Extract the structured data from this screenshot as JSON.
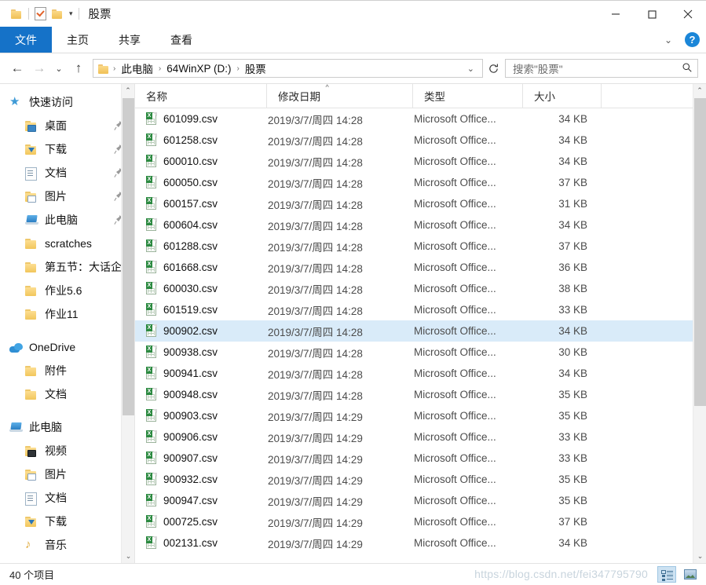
{
  "window": {
    "title": "股票",
    "quick_access_toolbar": [
      {
        "icon": "folder-icon",
        "name": "explorer-icon"
      },
      {
        "icon": "properties-icon",
        "name": "properties-icon"
      },
      {
        "icon": "folder-icon",
        "name": "new-folder-icon"
      },
      {
        "icon": "chevron-down-icon",
        "name": "customize-qat-icon"
      }
    ],
    "controls": {
      "minimize": "—",
      "maximize": "☐",
      "close": "✕"
    }
  },
  "ribbon": {
    "tabs": [
      {
        "label": "文件",
        "active": true
      },
      {
        "label": "主页",
        "active": false
      },
      {
        "label": "共享",
        "active": false
      },
      {
        "label": "查看",
        "active": false
      }
    ],
    "expand_icon": "chevron-down-icon",
    "help_label": "?"
  },
  "navbar": {
    "back_icon": "arrow-left-icon",
    "forward_icon": "arrow-right-icon",
    "recent_icon": "chevron-down-icon",
    "up_icon": "arrow-up-icon",
    "breadcrumb": [
      "此电脑",
      "64WinXP (D:)",
      "股票"
    ],
    "breadcrumb_separator": "›",
    "address_dropdown_icon": "chevron-down-icon",
    "refresh_icon": "refresh-icon",
    "search": {
      "placeholder": "搜索\"股票\"",
      "icon": "search-icon"
    }
  },
  "sidebar": {
    "sections": [
      {
        "header": {
          "label": "快速访问",
          "icon": "star-icon"
        },
        "items": [
          {
            "label": "桌面",
            "icon": "folder-desktop-icon",
            "pinned": true
          },
          {
            "label": "下载",
            "icon": "folder-downloads-icon",
            "pinned": true
          },
          {
            "label": "文档",
            "icon": "folder-documents-icon",
            "pinned": true
          },
          {
            "label": "图片",
            "icon": "folder-pictures-icon",
            "pinned": true
          },
          {
            "label": "此电脑",
            "icon": "computer-icon",
            "pinned": true
          },
          {
            "label": "scratches",
            "icon": "folder-icon",
            "pinned": false
          },
          {
            "label": "第五节：大话企业",
            "icon": "folder-icon",
            "pinned": false
          },
          {
            "label": "作业5.6",
            "icon": "folder-icon",
            "pinned": false
          },
          {
            "label": "作业11",
            "icon": "folder-icon",
            "pinned": false
          }
        ]
      },
      {
        "header": {
          "label": "OneDrive",
          "icon": "onedrive-icon"
        },
        "items": [
          {
            "label": "附件",
            "icon": "folder-icon",
            "pinned": false
          },
          {
            "label": "文档",
            "icon": "folder-icon",
            "pinned": false
          }
        ]
      },
      {
        "header": {
          "label": "此电脑",
          "icon": "computer-icon"
        },
        "items": [
          {
            "label": "视频",
            "icon": "folder-videos-icon",
            "pinned": false
          },
          {
            "label": "图片",
            "icon": "folder-pictures-icon",
            "pinned": false
          },
          {
            "label": "文档",
            "icon": "folder-documents-icon",
            "pinned": false
          },
          {
            "label": "下载",
            "icon": "folder-downloads-icon",
            "pinned": false
          },
          {
            "label": "音乐",
            "icon": "folder-music-icon",
            "pinned": false
          }
        ]
      }
    ]
  },
  "filelist": {
    "columns": [
      {
        "label": "名称",
        "sorted": false
      },
      {
        "label": "修改日期",
        "sorted": true,
        "direction": "asc"
      },
      {
        "label": "类型",
        "sorted": false
      },
      {
        "label": "大小",
        "sorted": false
      }
    ],
    "sort_arrow": "^",
    "rows": [
      {
        "name": "601099.csv",
        "date": "2019/3/7/周四 14:28",
        "type": "Microsoft Office...",
        "size": "34 KB",
        "selected": false
      },
      {
        "name": "601258.csv",
        "date": "2019/3/7/周四 14:28",
        "type": "Microsoft Office...",
        "size": "34 KB",
        "selected": false
      },
      {
        "name": "600010.csv",
        "date": "2019/3/7/周四 14:28",
        "type": "Microsoft Office...",
        "size": "34 KB",
        "selected": false
      },
      {
        "name": "600050.csv",
        "date": "2019/3/7/周四 14:28",
        "type": "Microsoft Office...",
        "size": "37 KB",
        "selected": false
      },
      {
        "name": "600157.csv",
        "date": "2019/3/7/周四 14:28",
        "type": "Microsoft Office...",
        "size": "31 KB",
        "selected": false
      },
      {
        "name": "600604.csv",
        "date": "2019/3/7/周四 14:28",
        "type": "Microsoft Office...",
        "size": "34 KB",
        "selected": false
      },
      {
        "name": "601288.csv",
        "date": "2019/3/7/周四 14:28",
        "type": "Microsoft Office...",
        "size": "37 KB",
        "selected": false
      },
      {
        "name": "601668.csv",
        "date": "2019/3/7/周四 14:28",
        "type": "Microsoft Office...",
        "size": "36 KB",
        "selected": false
      },
      {
        "name": "600030.csv",
        "date": "2019/3/7/周四 14:28",
        "type": "Microsoft Office...",
        "size": "38 KB",
        "selected": false
      },
      {
        "name": "601519.csv",
        "date": "2019/3/7/周四 14:28",
        "type": "Microsoft Office...",
        "size": "33 KB",
        "selected": false
      },
      {
        "name": "900902.csv",
        "date": "2019/3/7/周四 14:28",
        "type": "Microsoft Office...",
        "size": "34 KB",
        "selected": true
      },
      {
        "name": "900938.csv",
        "date": "2019/3/7/周四 14:28",
        "type": "Microsoft Office...",
        "size": "30 KB",
        "selected": false
      },
      {
        "name": "900941.csv",
        "date": "2019/3/7/周四 14:28",
        "type": "Microsoft Office...",
        "size": "34 KB",
        "selected": false
      },
      {
        "name": "900948.csv",
        "date": "2019/3/7/周四 14:28",
        "type": "Microsoft Office...",
        "size": "35 KB",
        "selected": false
      },
      {
        "name": "900903.csv",
        "date": "2019/3/7/周四 14:29",
        "type": "Microsoft Office...",
        "size": "35 KB",
        "selected": false
      },
      {
        "name": "900906.csv",
        "date": "2019/3/7/周四 14:29",
        "type": "Microsoft Office...",
        "size": "33 KB",
        "selected": false
      },
      {
        "name": "900907.csv",
        "date": "2019/3/7/周四 14:29",
        "type": "Microsoft Office...",
        "size": "33 KB",
        "selected": false
      },
      {
        "name": "900932.csv",
        "date": "2019/3/7/周四 14:29",
        "type": "Microsoft Office...",
        "size": "35 KB",
        "selected": false
      },
      {
        "name": "900947.csv",
        "date": "2019/3/7/周四 14:29",
        "type": "Microsoft Office...",
        "size": "35 KB",
        "selected": false
      },
      {
        "name": "000725.csv",
        "date": "2019/3/7/周四 14:29",
        "type": "Microsoft Office...",
        "size": "37 KB",
        "selected": false
      },
      {
        "name": "002131.csv",
        "date": "2019/3/7/周四 14:29",
        "type": "Microsoft Office...",
        "size": "34 KB",
        "selected": false
      }
    ]
  },
  "statusbar": {
    "item_count": "40 个项目",
    "view_buttons": [
      {
        "name": "details-view",
        "active": true
      },
      {
        "name": "large-icons-view",
        "active": false
      }
    ]
  },
  "watermark": "https://blog.csdn.net/fei347795790"
}
